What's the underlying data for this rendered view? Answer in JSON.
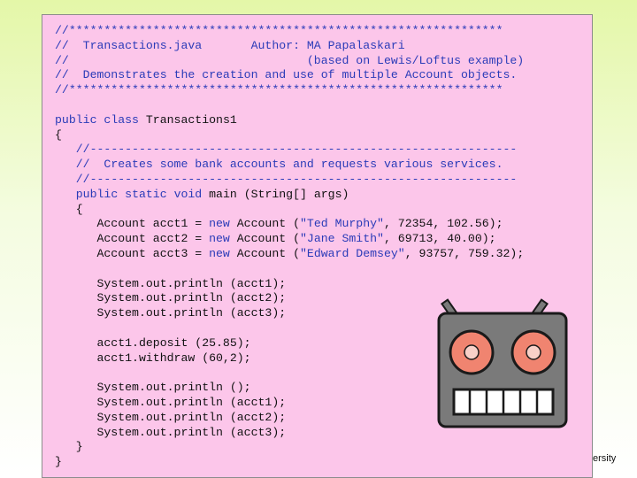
{
  "code": {
    "header": [
      "//**************************************************************",
      "//  Transactions.java       Author: MA Papalaskari",
      "//                                  (based on Lewis/Loftus example)",
      "//  Demonstrates the creation and use of multiple Account objects.",
      "//**************************************************************"
    ],
    "kw_public": "public",
    "kw_class": "class",
    "class_name": " Transactions1",
    "open_brace": "{",
    "comment_rule": "//-------------------------------------------------------------",
    "comment_text": "//  Creates some bank accounts and requests various services.",
    "kw_static": "static",
    "kw_void": "void",
    "method_sig": " main (String[] args)",
    "kw_new": "new",
    "acct_lines": [
      {
        "decl": "Account acct1 = ",
        "ctor": " Account (",
        "name": "\"Ted Murphy\"",
        "args": ", 72354, 102.56);"
      },
      {
        "decl": "Account acct2 = ",
        "ctor": " Account (",
        "name": "\"Jane Smith\"",
        "args": ", 69713, 40.00);"
      },
      {
        "decl": "Account acct3 = ",
        "ctor": " Account (",
        "name": "\"Edward Demsey\"",
        "args": ", 93757, 759.32);"
      }
    ],
    "print_lines_1": [
      "System.out.println (acct1);",
      "System.out.println (acct2);",
      "System.out.println (acct3);"
    ],
    "ops": [
      "acct1.deposit (25.85);",
      "acct1.withdraw (60,2);"
    ],
    "print_lines_2": [
      "System.out.println ();",
      "System.out.println (acct1);",
      "System.out.println (acct2);",
      "System.out.println (acct3);"
    ],
    "close_brace": "}"
  },
  "footer_fragment": "ersity",
  "robot": {
    "icon": "robot-icon",
    "colors": {
      "head": "#7a7a7a",
      "eye": "#f08470",
      "mouth": "#ffffff",
      "outline": "#1a1a1a"
    }
  }
}
